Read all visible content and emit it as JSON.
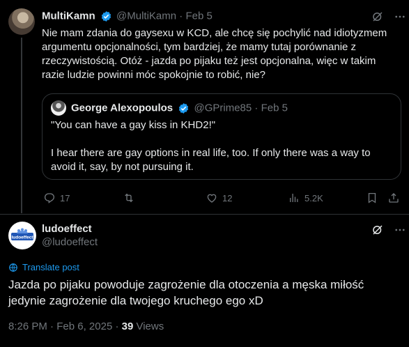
{
  "quoted_tweet": {
    "author_name": "MultiKamn",
    "handle": "@MultiKamn",
    "date": "Feb 5",
    "separator": "·",
    "text": "Nie mam zdania do gaysexu w KCD, ale chcę się pochylić nad idiotyzmem argumentu opcjonalności, tym bardziej, że mamy tutaj porównanie z rzeczywistością. Otóż - jazda po pijaku też jest opcjonalna, więc w takim razie ludzie powinni móc spokojnie to robić, nie?",
    "embedded_quote": {
      "author_name": "George Alexopoulos",
      "handle": "@GPrime85",
      "date": "Feb 5",
      "line1": "\"You can have a gay kiss in KHD2!\"",
      "line2": "I hear there are gay options in real life, too. If only there was a way to avoid it, say, by not pursuing it."
    },
    "actions": {
      "replies": "17",
      "retweets": "",
      "likes": "12",
      "views": "5.2K"
    }
  },
  "main_tweet": {
    "author_name": "ludoeffect",
    "handle": "@ludoeffect",
    "avatar_text": "ludoeffect",
    "translate_label": "Translate post",
    "text": "Jazda po pijaku powoduje zagrożenie dla otoczenia a męska miłość jedynie zagrożenie dla twojego kruchego ego xD",
    "time": "8:26 PM",
    "date": "Feb 6, 2025",
    "separator": "·",
    "views_count": "39",
    "views_label": "Views"
  },
  "colors": {
    "background": "#000000",
    "text": "#e7e9ea",
    "muted": "#71767b",
    "accent": "#1d9bf0",
    "border": "#2f3336"
  },
  "icons": [
    "verified-badge-icon",
    "grok-icon",
    "more-icon",
    "reply-icon",
    "retweet-icon",
    "like-icon",
    "views-icon",
    "bookmark-icon",
    "share-icon",
    "translate-icon"
  ]
}
